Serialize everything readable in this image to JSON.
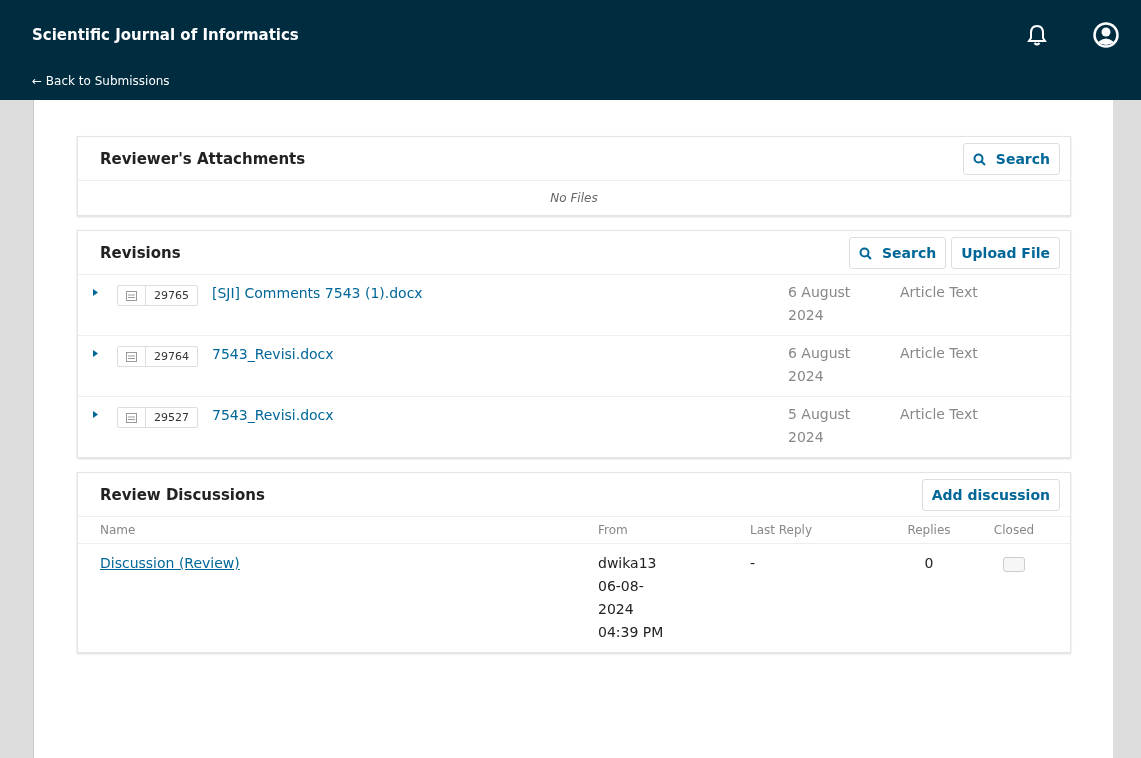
{
  "header": {
    "title": "Scientific Journal of Informatics",
    "back_link": "← Back to Submissions"
  },
  "attachments": {
    "title": "Reviewer's Attachments",
    "search_button": "Search",
    "empty_text": "No Files"
  },
  "revisions": {
    "title": "Revisions",
    "search_button": "Search",
    "upload_button": "Upload File",
    "files": [
      {
        "expanded": false,
        "id": "29765",
        "name": "[SJI] Comments 7543 (1).docx",
        "date": "6 August 2024",
        "genre": "Article Text"
      },
      {
        "expanded": false,
        "id": "29764",
        "name": "7543_Revisi.docx",
        "date": "6 August 2024",
        "genre": "Article Text"
      },
      {
        "expanded": false,
        "id": "29527",
        "name": "7543_Revisi.docx",
        "date": "5 August 2024",
        "genre": "Article Text"
      }
    ]
  },
  "discussions": {
    "title": "Review Discussions",
    "add_button": "Add discussion",
    "columns": [
      "Name",
      "From",
      "Last Reply",
      "Replies",
      "Closed"
    ],
    "rows": [
      {
        "name": "Discussion (Review)",
        "from": "dwika13 06-08-2024 04:39 PM",
        "last_reply": "-",
        "replies": "0",
        "closed": false
      }
    ]
  }
}
